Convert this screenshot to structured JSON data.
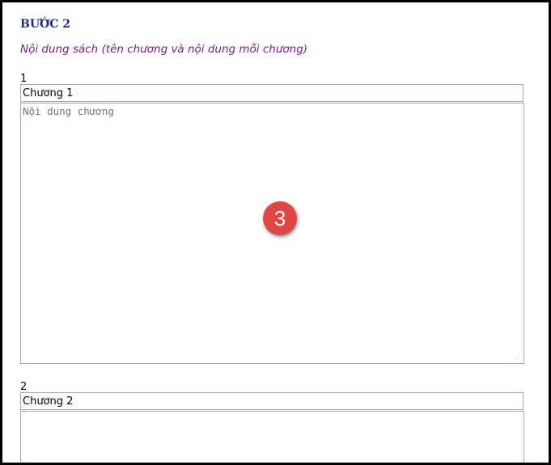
{
  "step": {
    "title": "BƯỚC 2",
    "description": "Nội dung sách (tên chương và nội dung mỗi chương)"
  },
  "chapters": [
    {
      "number": "1",
      "title_value": "Chương 1",
      "content_placeholder": "Nội dung chương"
    },
    {
      "number": "2",
      "title_value": "Chương 2",
      "content_placeholder": ""
    }
  ],
  "badge": {
    "label": "3"
  },
  "colors": {
    "title": "#1f2d7a",
    "description": "#7a1f8a",
    "badge": "#e04646",
    "border": "#a9a9a9"
  }
}
